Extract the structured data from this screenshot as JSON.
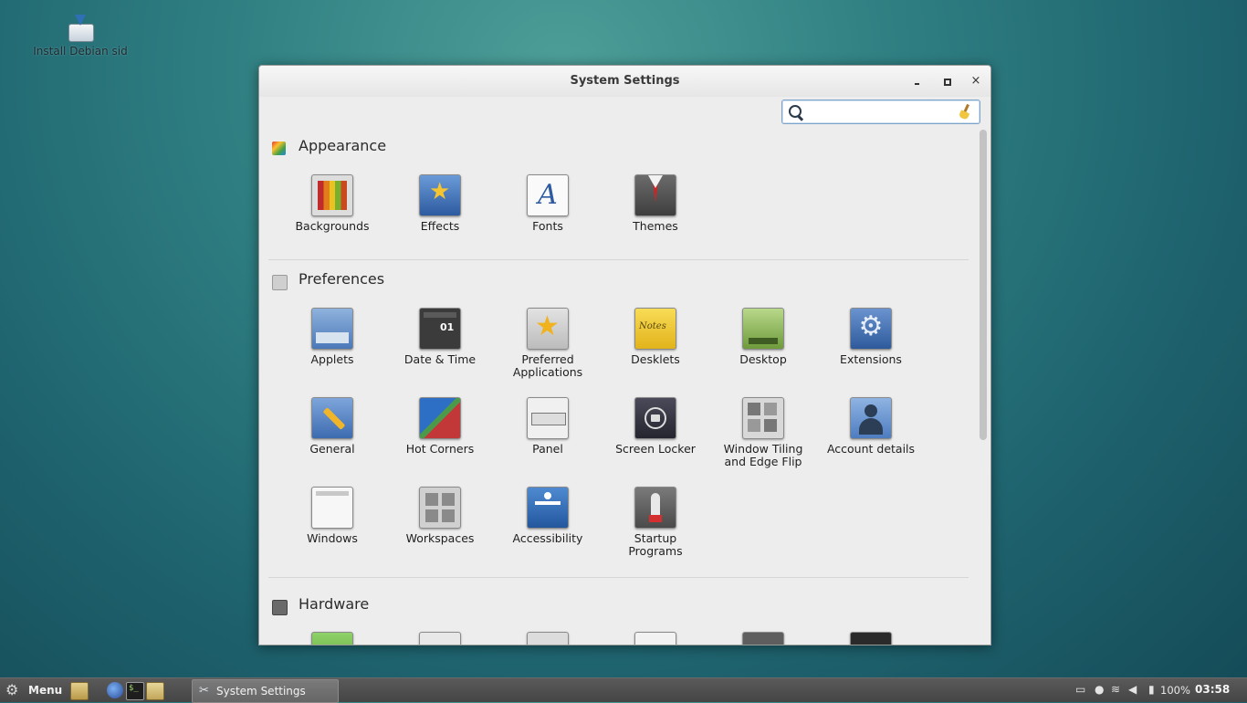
{
  "desktop": {
    "icon_label": "Install Debian sid"
  },
  "window": {
    "title": "System Settings",
    "controls": {
      "minimize": "",
      "maximize": "",
      "close": "×"
    },
    "search": {
      "value": "",
      "placeholder": ""
    }
  },
  "sections": [
    {
      "title": "Appearance",
      "items": [
        {
          "label": "Backgrounds"
        },
        {
          "label": "Effects"
        },
        {
          "label": "Fonts"
        },
        {
          "label": "Themes"
        }
      ]
    },
    {
      "title": "Preferences",
      "items": [
        {
          "label": "Applets"
        },
        {
          "label": "Date & Time"
        },
        {
          "label": "Preferred Applications"
        },
        {
          "label": "Desklets"
        },
        {
          "label": "Desktop"
        },
        {
          "label": "Extensions"
        },
        {
          "label": "General"
        },
        {
          "label": "Hot Corners"
        },
        {
          "label": "Panel"
        },
        {
          "label": "Screen Locker"
        },
        {
          "label": "Window Tiling and Edge Flip"
        },
        {
          "label": "Account details"
        },
        {
          "label": "Windows"
        },
        {
          "label": "Workspaces"
        },
        {
          "label": "Accessibility"
        },
        {
          "label": "Startup Programs"
        }
      ]
    },
    {
      "title": "Hardware",
      "items": []
    }
  ],
  "taskbar": {
    "menu_label": "Menu",
    "task_label": "System Settings",
    "battery": "100%",
    "clock": "03:58"
  },
  "colors": {
    "accent": "#2d5aa0",
    "taskbar": "#4f4f4f",
    "window_bg": "#ededed"
  }
}
